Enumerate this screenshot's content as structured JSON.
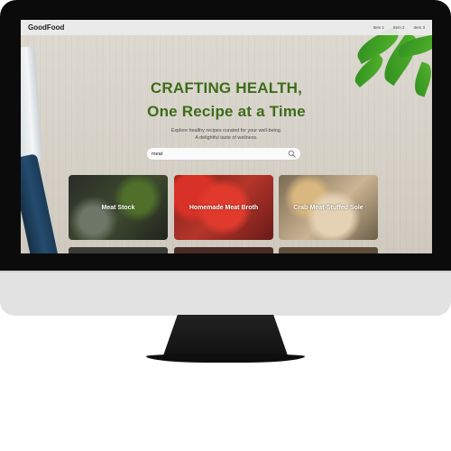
{
  "app": {
    "logo": "GoodFood",
    "nav_items": [
      "Item 1",
      "Item 2",
      "Item 3"
    ]
  },
  "hero": {
    "title_line1": "CRAFTING HEALTH,",
    "title_line2": "One Recipe at a Time",
    "subtitle_line1": "Explore healthy recipes curated for your well-being.",
    "subtitle_line2": "A delightful taste of wellness."
  },
  "search": {
    "value": "meat",
    "icon": "search-icon"
  },
  "cards": [
    {
      "label": "Meat Stock"
    },
    {
      "label": "Homemade Meat Broth"
    },
    {
      "label": "Crab-Meat-Stuffed Sole"
    }
  ],
  "colors": {
    "accent_green": "#3d6b1a",
    "bezel": "#0b0b0b",
    "chin": "#e2e2e2"
  }
}
